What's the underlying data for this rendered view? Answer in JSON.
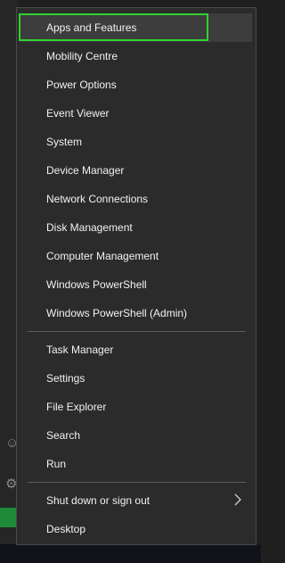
{
  "menu": {
    "items": [
      {
        "label": "Apps and Features"
      },
      {
        "label": "Mobility Centre"
      },
      {
        "label": "Power Options"
      },
      {
        "label": "Event Viewer"
      },
      {
        "label": "System"
      },
      {
        "label": "Device Manager"
      },
      {
        "label": "Network Connections"
      },
      {
        "label": "Disk Management"
      },
      {
        "label": "Computer Management"
      },
      {
        "label": "Windows PowerShell"
      },
      {
        "label": "Windows PowerShell (Admin)"
      },
      {
        "label": "Task Manager"
      },
      {
        "label": "Settings"
      },
      {
        "label": "File Explorer"
      },
      {
        "label": "Search"
      },
      {
        "label": "Run"
      },
      {
        "label": "Shut down or sign out"
      },
      {
        "label": "Desktop"
      }
    ],
    "submenu_icon": "chevron-right-icon",
    "focus_color": "#2fd22f"
  }
}
